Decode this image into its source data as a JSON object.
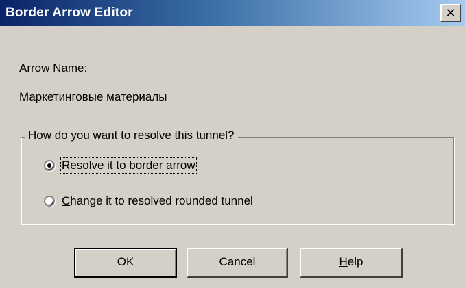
{
  "window": {
    "title": "Border Arrow Editor",
    "close_symbol": "✕",
    "close_icon": "close-icon"
  },
  "arrow": {
    "name_label": "Arrow Name:",
    "name_value": "Маркетинговые материалы"
  },
  "resolve_group": {
    "legend": "How do you want to resolve this tunnel?",
    "options": [
      {
        "mnemonic": "R",
        "rest": "esolve it to border arrow",
        "selected": true
      },
      {
        "mnemonic": "C",
        "rest": "hange it to resolved rounded tunnel",
        "selected": false
      }
    ]
  },
  "buttons": {
    "ok": "OK",
    "cancel": "Cancel",
    "help_mnemonic": "H",
    "help_rest": "elp"
  },
  "colors": {
    "title_start": "#0a246a",
    "title_end": "#a6caf0",
    "face": "#d4d0c8"
  }
}
